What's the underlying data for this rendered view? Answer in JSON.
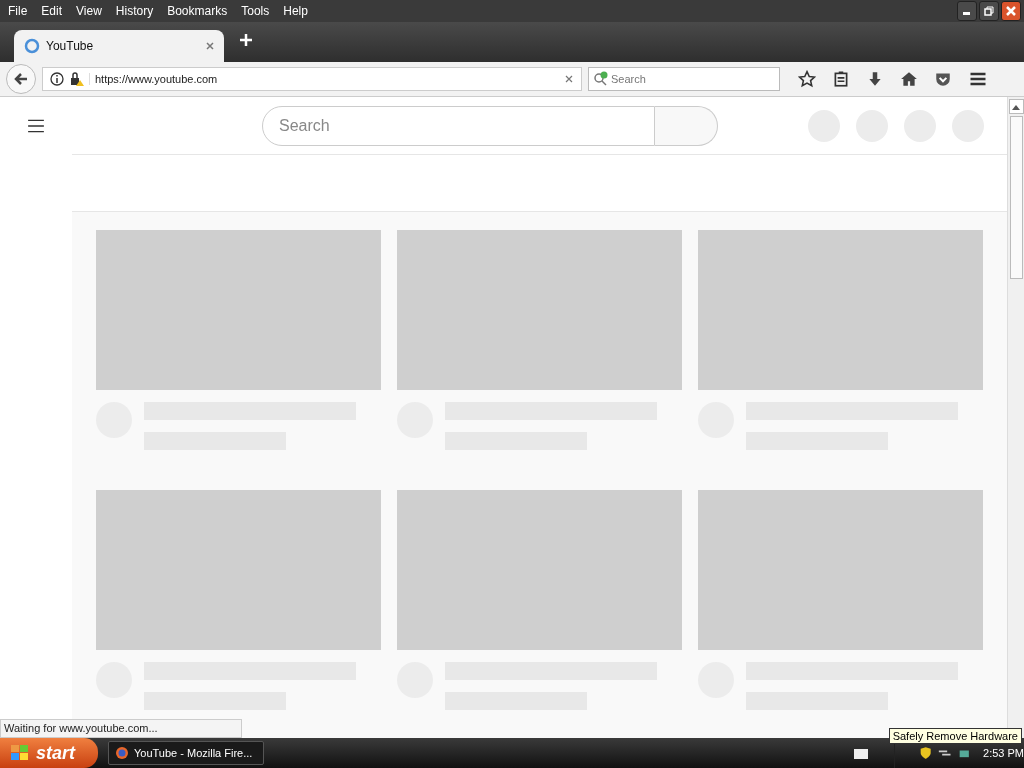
{
  "menu": [
    "File",
    "Edit",
    "View",
    "History",
    "Bookmarks",
    "Tools",
    "Help"
  ],
  "tabs": [
    {
      "title": "YouTube",
      "selected": true
    }
  ],
  "address": {
    "url": "https://www.youtube.com"
  },
  "browser_search": {
    "placeholder": "Search"
  },
  "page": {
    "search": {
      "placeholder": "Search"
    },
    "header_placeholders": [
      {
        "kind": "circle"
      },
      {
        "kind": "circle"
      },
      {
        "kind": "circle"
      },
      {
        "kind": "circle"
      }
    ],
    "video_placeholders": [
      {
        "kind": "skeleton"
      },
      {
        "kind": "skeleton"
      },
      {
        "kind": "skeleton"
      },
      {
        "kind": "skeleton"
      },
      {
        "kind": "skeleton"
      },
      {
        "kind": "skeleton"
      }
    ]
  },
  "status_bar": "Waiting for www.youtube.com...",
  "taskbar": {
    "start": "start",
    "tasks": [
      {
        "title": "YouTube - Mozilla Fire...",
        "selected": true
      }
    ],
    "clock": "2:53 PM",
    "tooltip": "Safely Remove Hardware"
  }
}
